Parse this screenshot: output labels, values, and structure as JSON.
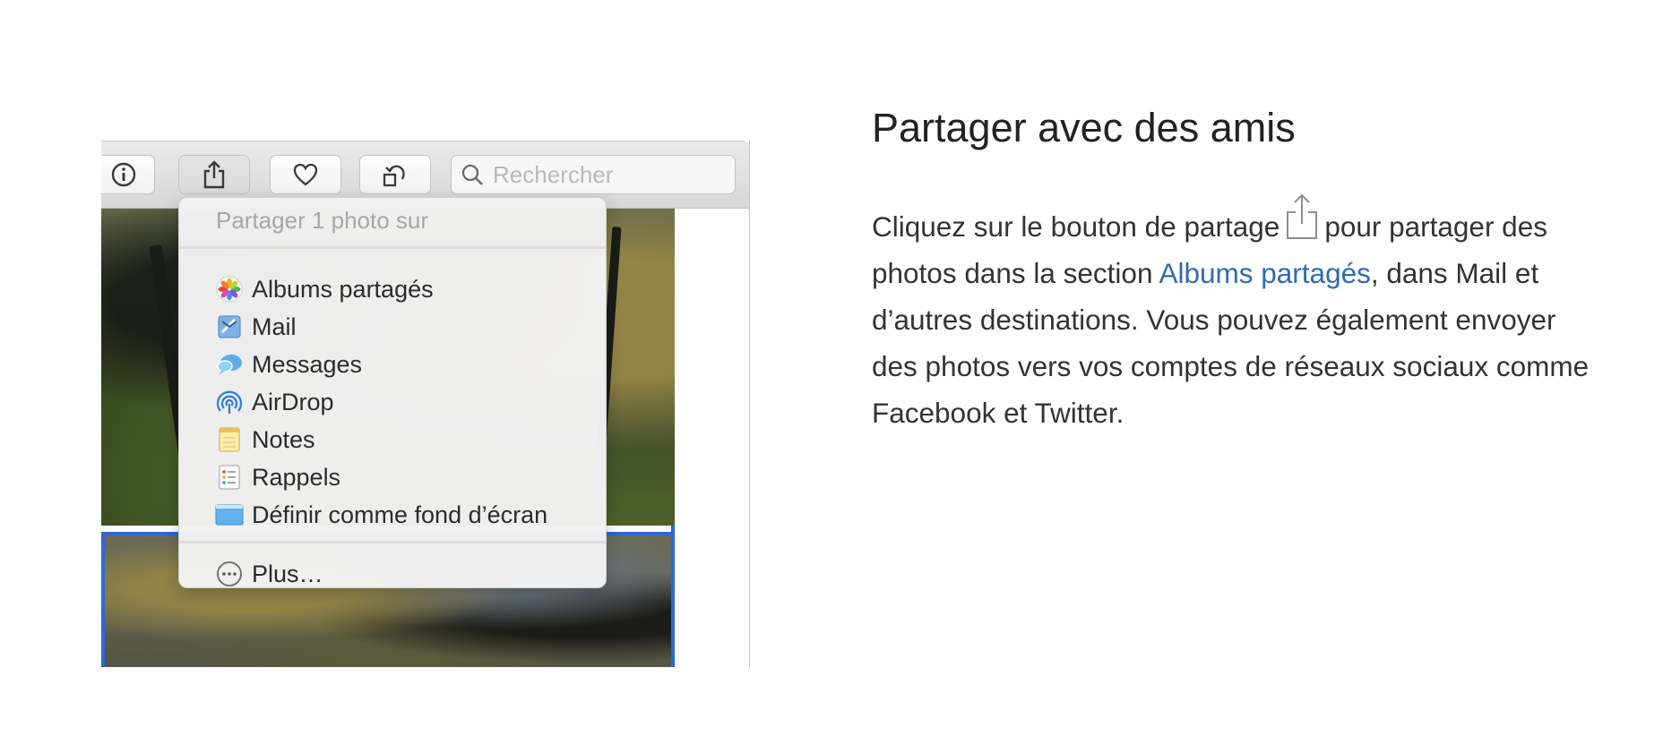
{
  "toolbar": {
    "search_placeholder": "Rechercher"
  },
  "share_menu": {
    "header": "Partager 1 photo sur",
    "items": [
      {
        "label": "Albums partagés",
        "icon": "photos-icon"
      },
      {
        "label": "Mail",
        "icon": "mail-icon"
      },
      {
        "label": "Messages",
        "icon": "messages-icon"
      },
      {
        "label": "AirDrop",
        "icon": "airdrop-icon"
      },
      {
        "label": "Notes",
        "icon": "notes-icon"
      },
      {
        "label": "Rappels",
        "icon": "reminders-icon"
      },
      {
        "label": "Définir comme fond d’écran",
        "icon": "wallpaper-icon"
      }
    ],
    "more": {
      "label": "Plus…",
      "icon": "more-icon"
    }
  },
  "article": {
    "title": "Partager avec des amis",
    "text_1": "Cliquez sur le bouton de partage",
    "text_2": "pour partager des photos dans la section",
    "link_label": "Albums partagés",
    "text_3": ", dans Mail et d’autres destinations. Vous pouvez également envoyer des photos vers vos comptes de réseaux sociaux comme Facebook et Twitter."
  },
  "colors": {
    "link": "#2f6ab6",
    "selection": "#2f66d6"
  }
}
